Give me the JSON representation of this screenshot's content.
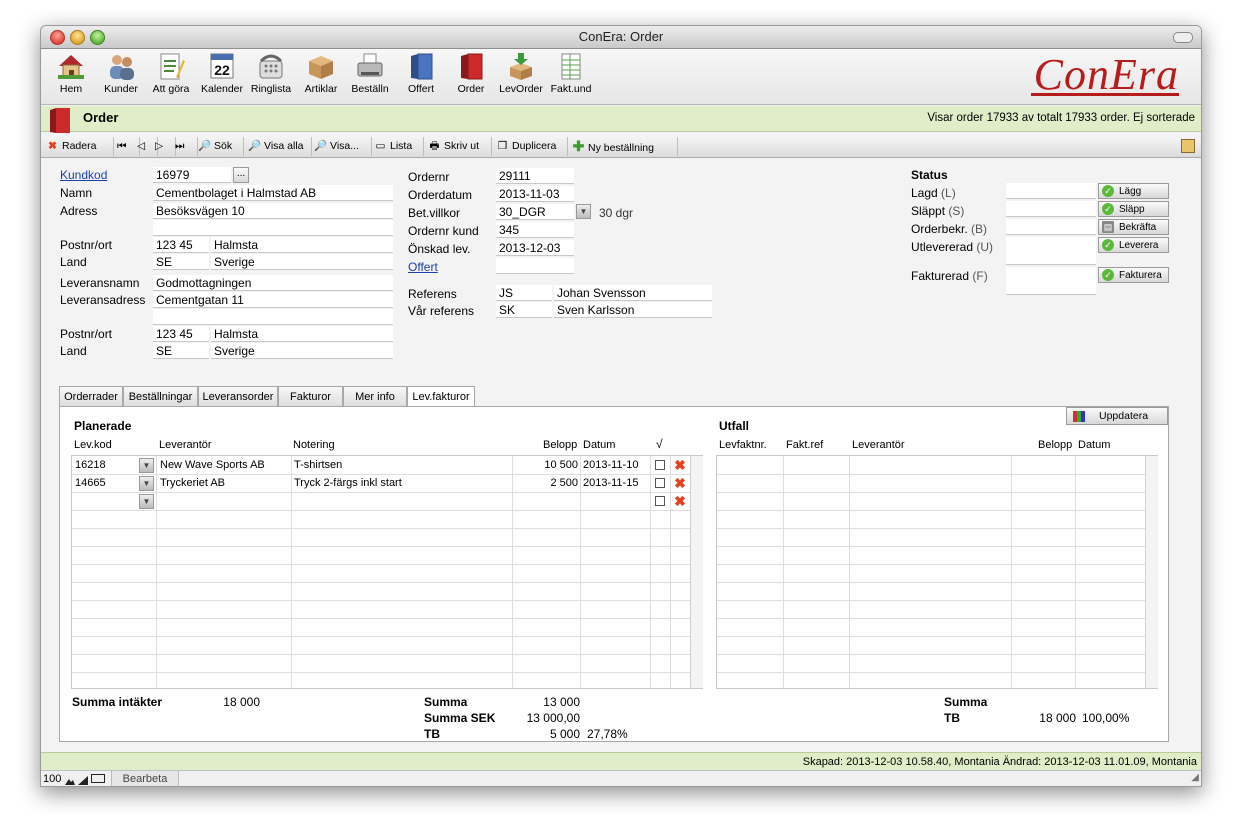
{
  "window": {
    "title": "ConEra: Order"
  },
  "toolbar": {
    "items": [
      {
        "label": "Hem",
        "icon": "house-icon"
      },
      {
        "label": "Kunder",
        "icon": "people-icon"
      },
      {
        "label": "Att göra",
        "icon": "notepad-icon"
      },
      {
        "label": "Kalender",
        "icon": "calendar-icon",
        "day": "22"
      },
      {
        "label": "Ringlista",
        "icon": "phone-icon"
      },
      {
        "label": "Artiklar",
        "icon": "box-icon"
      },
      {
        "label": "Beställn",
        "icon": "fax-icon"
      },
      {
        "label": "Offert",
        "icon": "binder-blue-icon"
      },
      {
        "label": "Order",
        "icon": "binder-red-icon"
      },
      {
        "label": "LevOrder",
        "icon": "box-arrow-icon"
      },
      {
        "label": "Fakt.und",
        "icon": "spreadsheet-icon"
      }
    ],
    "logo": "ConEra"
  },
  "header": {
    "title": "Order",
    "status": "Visar order 17933 av totalt 17933 order. Ej sorterade"
  },
  "actions": {
    "radera": "Radera",
    "sok": "Sök",
    "visa_alla": "Visa alla",
    "visa": "Visa...",
    "lista": "Lista",
    "skriv_ut": "Skriv ut",
    "duplicera": "Duplicera",
    "ny_bestallning": "Ny beställning"
  },
  "customer": {
    "kundkod_label": "Kundkod",
    "kundkod": "16979",
    "more_btn": "...",
    "namn_label": "Namn",
    "namn": "Cementbolaget i Halmstad AB",
    "adress_label": "Adress",
    "adress": "Besöksvägen 10",
    "postnr_label": "Postnr/ort",
    "postnr": "123 45",
    "ort": "Halmsta",
    "land_label": "Land",
    "land_code": "SE",
    "land": "Sverige",
    "levnamn_label": "Leveransnamn",
    "levnamn": "Godmottagningen",
    "levadress_label": "Leveransadress",
    "levadress": "Cementgatan 11",
    "lev_postnr_label": "Postnr/ort",
    "lev_postnr": "123 45",
    "lev_ort": "Halmsta",
    "lev_land_label": "Land",
    "lev_land_code": "SE",
    "lev_land": "Sverige"
  },
  "order": {
    "ordernr_label": "Ordernr",
    "ordernr": "29111",
    "orderdatum_label": "Orderdatum",
    "orderdatum": "2013-11-03",
    "betvillkor_label": "Bet.villkor",
    "betvillkor": "30_DGR",
    "betvillkor_text": "30 dgr",
    "ordernr_kund_label": "Ordernr kund",
    "ordernr_kund": "345",
    "onskad_lev_label": "Önskad lev.",
    "onskad_lev": "2013-12-03",
    "offert_label": "Offert",
    "referens_label": "Referens",
    "referens_code": "JS",
    "referens_name": "Johan Svensson",
    "var_ref_label": "Vår referens",
    "var_ref_code": "SK",
    "var_ref_name": "Sven Karlsson"
  },
  "status": {
    "title": "Status",
    "rows": [
      {
        "label": "Lagd",
        "key": "(L)",
        "button": "Lägg"
      },
      {
        "label": "Släppt",
        "key": "(S)",
        "button": "Släpp"
      },
      {
        "label": "Orderbekr.",
        "key": "(B)",
        "button": "Bekräfta"
      },
      {
        "label": "Utlevererad",
        "key": "(U)",
        "button": "Leverera"
      },
      {
        "label": "Fakturerad",
        "key": "(F)",
        "button": "Fakturera"
      }
    ]
  },
  "tabs": [
    "Orderrader",
    "Beställningar",
    "Leveransorder",
    "Fakturor",
    "Mer info",
    "Lev.fakturor"
  ],
  "planerade": {
    "title": "Planerade",
    "columns": [
      "Lev.kod",
      "Leverantör",
      "Notering",
      "Belopp",
      "Datum",
      "√"
    ],
    "rows": [
      {
        "levkod": "16218",
        "leverantor": "New Wave Sports AB",
        "notering": "T-shirtsen",
        "belopp": "10 500",
        "datum": "2013-11-10"
      },
      {
        "levkod": "14665",
        "leverantor": "Tryckeriet AB",
        "notering": "Tryck 2-färgs inkl start",
        "belopp": "2 500",
        "datum": "2013-11-15"
      }
    ]
  },
  "utfall": {
    "title": "Utfall",
    "update_button": "Uppdatera",
    "columns": [
      "Levfaktnr.",
      "Fakt.ref",
      "Leverantör",
      "Belopp",
      "Datum"
    ]
  },
  "summary": {
    "intakter_label": "Summa intäkter",
    "intakter": "18 000",
    "summa_label": "Summa",
    "summa": "13 000",
    "summa_sek_label": "Summa SEK",
    "summa_sek": "13 000,00",
    "tb_label": "TB",
    "tb": "5 000",
    "tb_pct": "27,78%",
    "utfall_summa_label": "Summa",
    "utfall_tb_label": "TB",
    "utfall_tb": "18 000",
    "utfall_tb_pct": "100,00%"
  },
  "footer": {
    "text": "Skapad: 2013-12-03 10.58.40, Montania Ändrad: 2013-12-03 11.01.09, Montania"
  },
  "bottombar": {
    "zoom": "100",
    "mode": "Bearbeta"
  }
}
